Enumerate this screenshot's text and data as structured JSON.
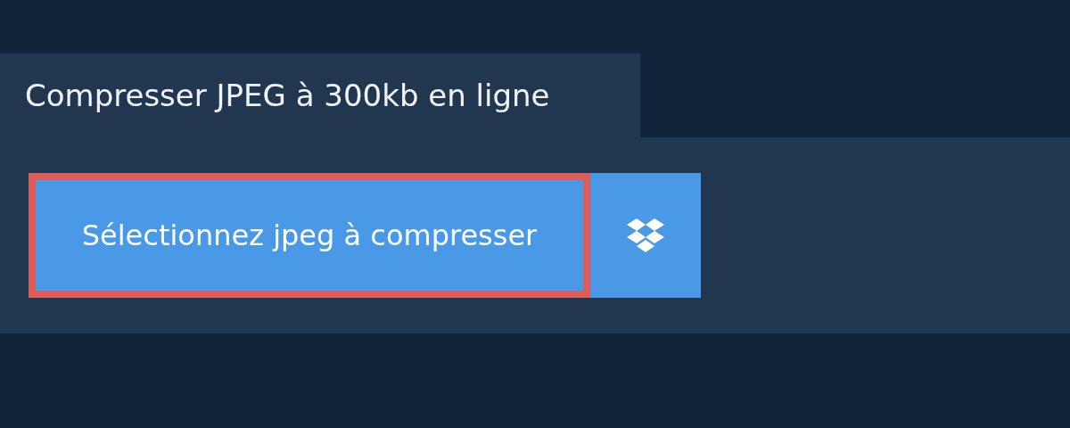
{
  "tab": {
    "title": "Compresser JPEG à 300kb en ligne"
  },
  "upload_button": {
    "label": "Sélectionnez jpeg à compresser",
    "focused": true
  }
}
